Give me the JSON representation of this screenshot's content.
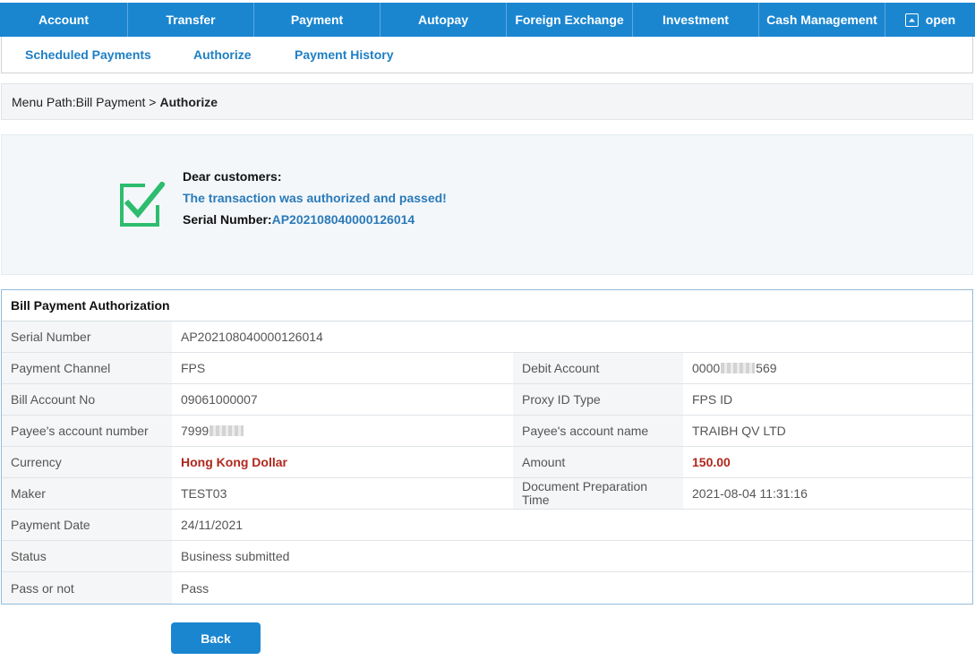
{
  "topnav": {
    "items": [
      {
        "label": "Account"
      },
      {
        "label": "Transfer"
      },
      {
        "label": "Payment"
      },
      {
        "label": "Autopay"
      },
      {
        "label": "Foreign Exchange"
      },
      {
        "label": "Investment"
      },
      {
        "label": "Cash Management"
      }
    ],
    "open_label": "open",
    "open_icon": "expand-up-icon"
  },
  "subnav": {
    "items": [
      {
        "label": "Scheduled Payments"
      },
      {
        "label": "Authorize"
      },
      {
        "label": "Payment History"
      }
    ]
  },
  "breadcrumb": {
    "prefix": "Menu Path:Bill Payment >",
    "current": "Authorize"
  },
  "success": {
    "icon": "checkbox-checked-icon",
    "greeting": "Dear customers:",
    "message": "The transaction was authorized and passed!",
    "serial_label": "Serial Number:",
    "serial_value": "AP202108040000126014",
    "accent_color": "#2a7ab8",
    "icon_color": "#2ebc6e"
  },
  "detail": {
    "title": "Bill Payment Authorization",
    "serial_number": {
      "label": "Serial Number",
      "value": "AP202108040000126014"
    },
    "payment_channel": {
      "label": "Payment Channel",
      "value": "FPS"
    },
    "debit_account": {
      "label": "Debit Account",
      "value_start": "0000",
      "value_end": "569"
    },
    "bill_account_no": {
      "label": "Bill Account No",
      "value": "09061000007"
    },
    "proxy_id_type": {
      "label": "Proxy ID Type",
      "value": "FPS ID"
    },
    "payee_account_number": {
      "label": "Payee's account number",
      "value_start": "7999"
    },
    "payee_account_name": {
      "label": "Payee's account name",
      "value": "TRAIBH QV LTD"
    },
    "currency": {
      "label": "Currency",
      "value": "Hong Kong Dollar"
    },
    "amount": {
      "label": "Amount",
      "value": "150.00"
    },
    "maker": {
      "label": "Maker",
      "value": "TEST03"
    },
    "doc_prep_time": {
      "label": "Document Preparation Time",
      "value": "2021-08-04 11:31:16"
    },
    "payment_date": {
      "label": "Payment Date",
      "value": "24/11/2021"
    },
    "status": {
      "label": "Status",
      "value": "Business submitted"
    },
    "pass_or_not": {
      "label": "Pass or not",
      "value": "Pass"
    },
    "highlight_color": "#b0271c"
  },
  "back_button": {
    "label": "Back"
  },
  "brand_color": "#1a86d0"
}
